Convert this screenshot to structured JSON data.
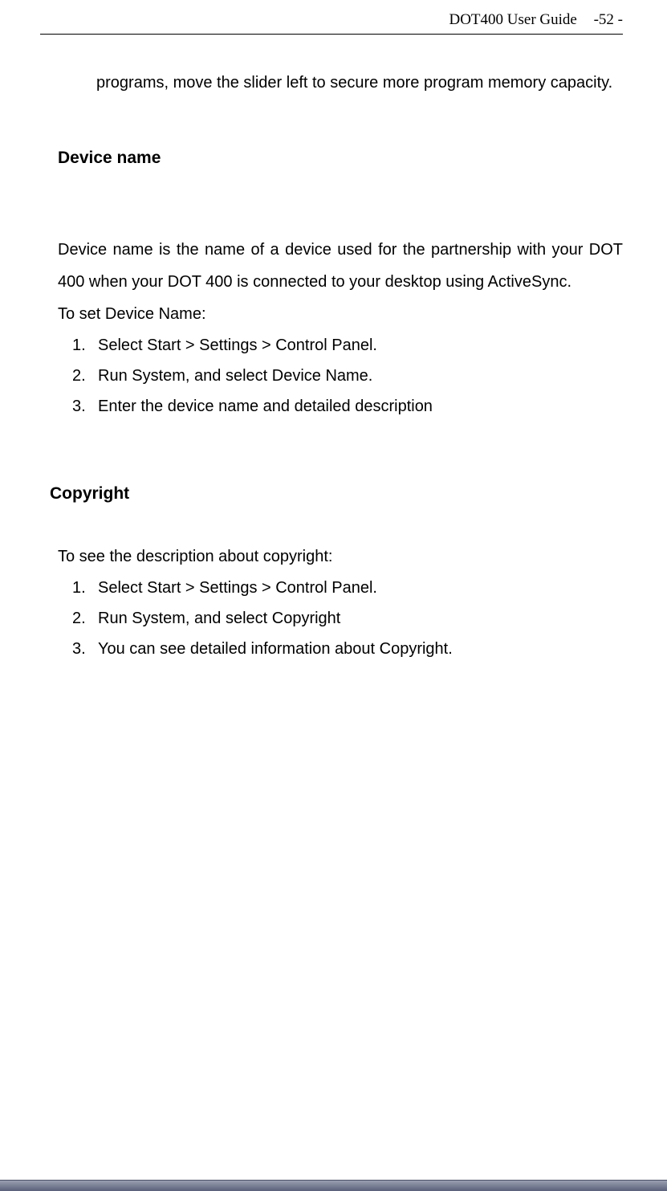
{
  "header": {
    "title": "DOT400 User Guide",
    "page": "-52 -"
  },
  "intro": {
    "text": "programs, move the slider left to secure more program memory capacity."
  },
  "section1": {
    "heading": "Device name",
    "paragraph": "Device name is the name of a device used for the partnership with your DOT 400 when your DOT 400 is connected to your desktop using ActiveSync.",
    "lead": "To set Device Name:",
    "items": [
      "Select Start > Settings > Control Panel.",
      "Run System, and select Device Name.",
      "Enter the device name and detailed description"
    ]
  },
  "section2": {
    "heading": "Copyright",
    "lead": "To see the description about copyright:",
    "items": [
      "Select Start > Settings > Control Panel.",
      "Run System, and select Copyright",
      "You can see detailed information about Copyright."
    ]
  }
}
